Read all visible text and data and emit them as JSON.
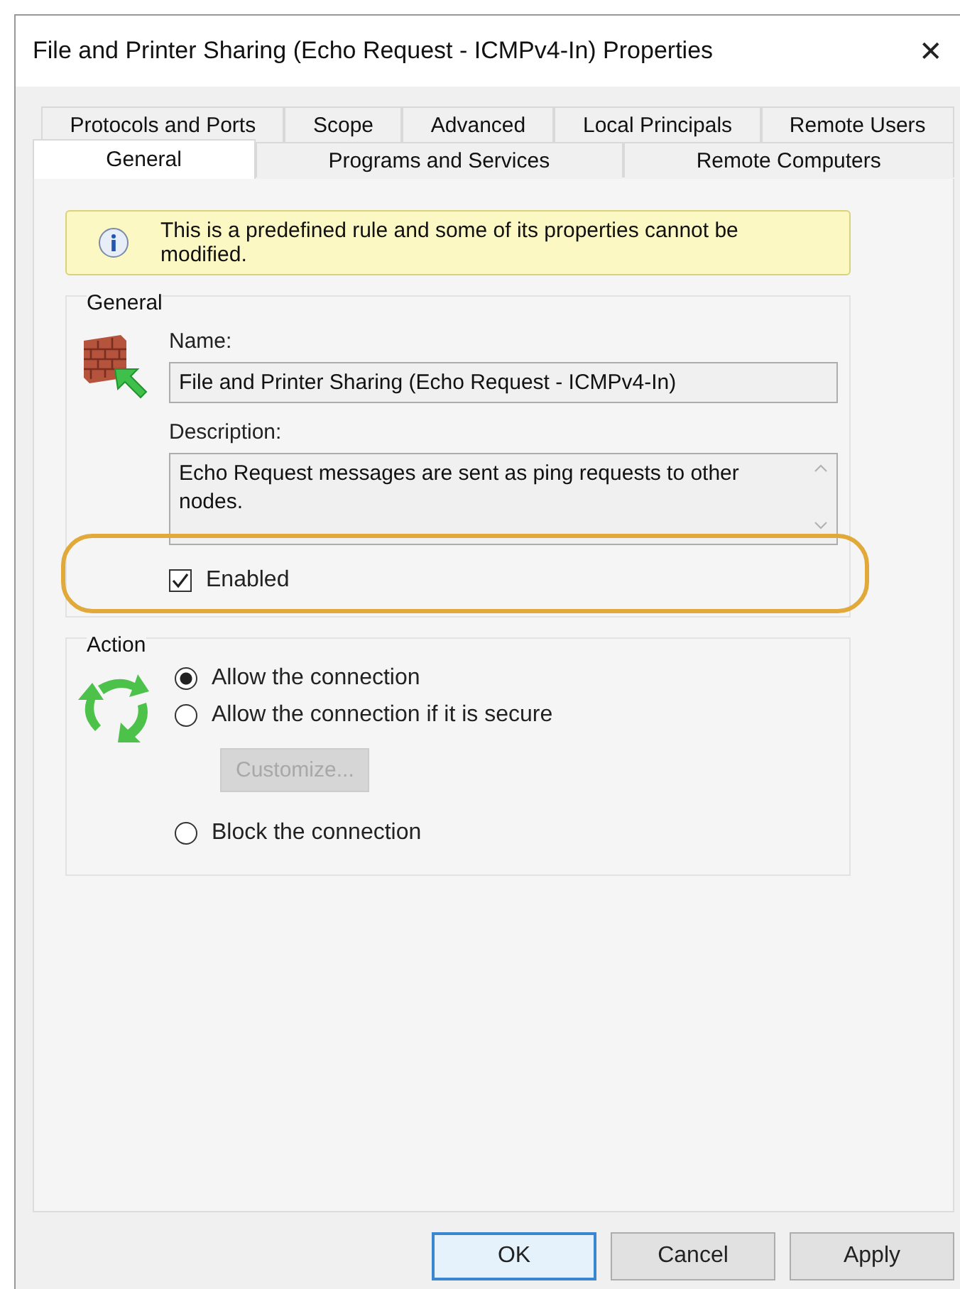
{
  "window": {
    "title": "File and Printer Sharing (Echo Request - ICMPv4-In) Properties",
    "close": "✕"
  },
  "tab_rows": [
    {
      "tabs": [
        {
          "label": "Protocols and Ports",
          "selected": false
        },
        {
          "label": "Scope",
          "selected": false
        },
        {
          "label": "Advanced",
          "selected": false
        },
        {
          "label": "Local Principals",
          "selected": false
        },
        {
          "label": "Remote Users",
          "selected": false
        }
      ]
    },
    {
      "tabs": [
        {
          "label": "General",
          "selected": true
        },
        {
          "label": "Programs and Services",
          "selected": false
        },
        {
          "label": "Remote Computers",
          "selected": false
        }
      ]
    }
  ],
  "info_bar": {
    "text": "This is a predefined rule and some of its properties cannot be modified."
  },
  "general": {
    "title": "General",
    "name_label": "Name:",
    "name_value": "File and Printer Sharing (Echo Request - ICMPv4-In)",
    "description_label": "Description:",
    "description_value": "Echo Request messages are sent as ping requests to other nodes.",
    "enabled": {
      "label": "Enabled",
      "checked": true,
      "highlighted": true
    }
  },
  "action": {
    "title": "Action",
    "options": [
      {
        "kind": "radio",
        "label": "Allow the connection",
        "selected": true
      },
      {
        "kind": "radio",
        "label": "Allow the connection if it is secure",
        "selected": false
      },
      {
        "kind": "button",
        "label": "Customize...",
        "disabled": true
      },
      {
        "kind": "radio",
        "label": "Block the connection",
        "selected": false
      }
    ]
  },
  "buttons": [
    {
      "label": "OK",
      "default": true
    },
    {
      "label": "Cancel",
      "default": false
    },
    {
      "label": "Apply",
      "default": false
    }
  ]
}
